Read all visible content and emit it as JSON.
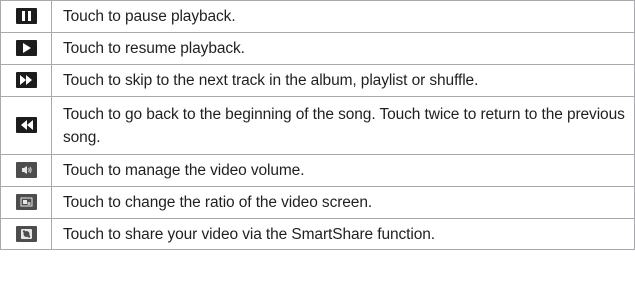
{
  "table": {
    "rows": [
      {
        "icon": "pause-icon",
        "text": "Touch to pause playback."
      },
      {
        "icon": "play-icon",
        "text": "Touch to resume playback."
      },
      {
        "icon": "fast-forward-icon",
        "text": "Touch to skip to the next track in the album, playlist or shuffle."
      },
      {
        "icon": "rewind-icon",
        "text": "Touch to go back to the beginning of the song. Touch twice to return to the previous song."
      },
      {
        "icon": "volume-icon",
        "text": "Touch to manage the video volume."
      },
      {
        "icon": "screen-ratio-icon",
        "text": "Touch to change the ratio of the video screen."
      },
      {
        "icon": "smartshare-icon",
        "text": "Touch to share your video via the SmartShare function."
      }
    ]
  },
  "colors": {
    "border": "#a7a9ac",
    "text": "#231f20",
    "icon_bg": "#1c1c1c"
  }
}
